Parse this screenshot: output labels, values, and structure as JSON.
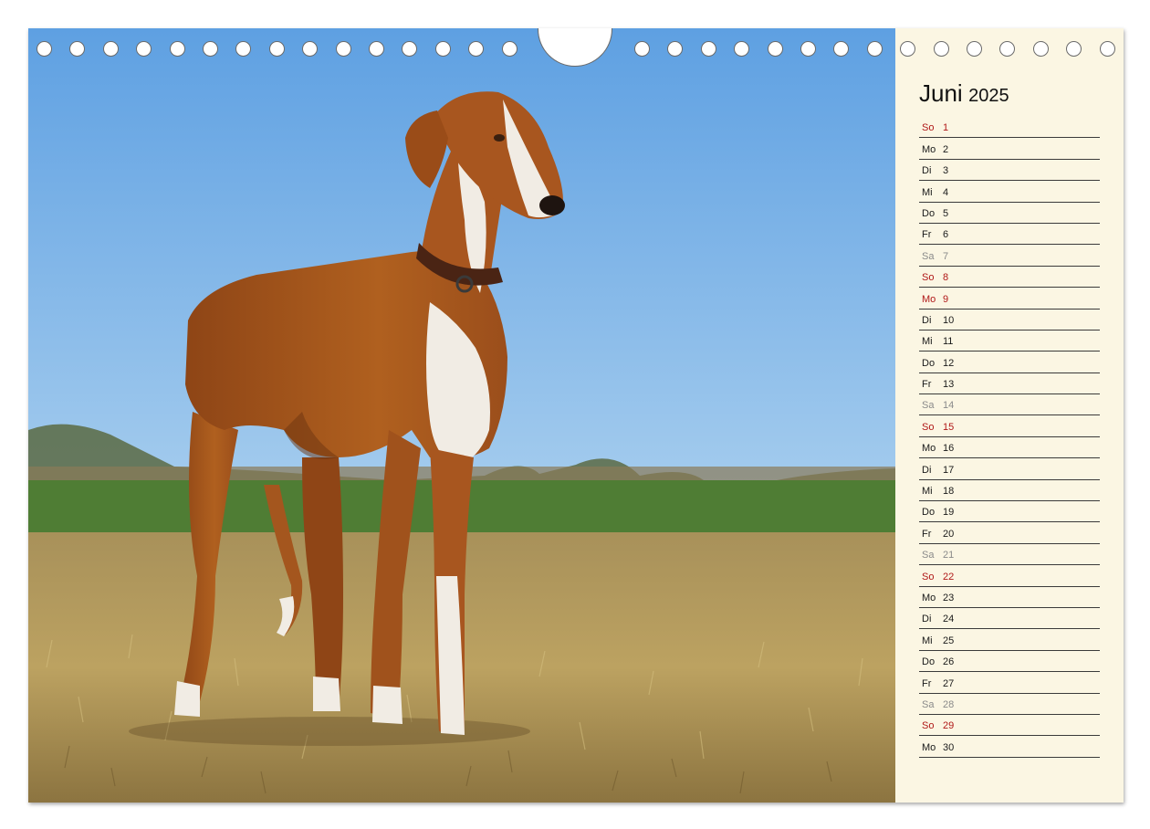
{
  "calendar": {
    "month": "Juni",
    "year": "2025",
    "days": [
      {
        "wd": "So",
        "n": "1",
        "type": "holiday"
      },
      {
        "wd": "Mo",
        "n": "2",
        "type": "weekday"
      },
      {
        "wd": "Di",
        "n": "3",
        "type": "weekday"
      },
      {
        "wd": "Mi",
        "n": "4",
        "type": "weekday"
      },
      {
        "wd": "Do",
        "n": "5",
        "type": "weekday"
      },
      {
        "wd": "Fr",
        "n": "6",
        "type": "weekday"
      },
      {
        "wd": "Sa",
        "n": "7",
        "type": "saturday"
      },
      {
        "wd": "So",
        "n": "8",
        "type": "holiday"
      },
      {
        "wd": "Mo",
        "n": "9",
        "type": "holiday"
      },
      {
        "wd": "Di",
        "n": "10",
        "type": "weekday"
      },
      {
        "wd": "Mi",
        "n": "11",
        "type": "weekday"
      },
      {
        "wd": "Do",
        "n": "12",
        "type": "weekday"
      },
      {
        "wd": "Fr",
        "n": "13",
        "type": "weekday"
      },
      {
        "wd": "Sa",
        "n": "14",
        "type": "saturday"
      },
      {
        "wd": "So",
        "n": "15",
        "type": "holiday"
      },
      {
        "wd": "Mo",
        "n": "16",
        "type": "weekday"
      },
      {
        "wd": "Di",
        "n": "17",
        "type": "weekday"
      },
      {
        "wd": "Mi",
        "n": "18",
        "type": "weekday"
      },
      {
        "wd": "Do",
        "n": "19",
        "type": "weekday"
      },
      {
        "wd": "Fr",
        "n": "20",
        "type": "weekday"
      },
      {
        "wd": "Sa",
        "n": "21",
        "type": "saturday"
      },
      {
        "wd": "So",
        "n": "22",
        "type": "holiday"
      },
      {
        "wd": "Mo",
        "n": "23",
        "type": "weekday"
      },
      {
        "wd": "Di",
        "n": "24",
        "type": "weekday"
      },
      {
        "wd": "Mi",
        "n": "25",
        "type": "weekday"
      },
      {
        "wd": "Do",
        "n": "26",
        "type": "weekday"
      },
      {
        "wd": "Fr",
        "n": "27",
        "type": "weekday"
      },
      {
        "wd": "Sa",
        "n": "28",
        "type": "saturday"
      },
      {
        "wd": "So",
        "n": "29",
        "type": "holiday"
      },
      {
        "wd": "Mo",
        "n": "30",
        "type": "weekday"
      }
    ]
  },
  "colors": {
    "sky": "#7db2e6",
    "field_green": "#4f7d34",
    "grass": "#b89d58",
    "dog_coat": "#a8561f",
    "dog_white": "#f1ece4",
    "holiday_red": "#b01818",
    "saturday_grey": "#8a8a8a",
    "panel_background": "#fbf6e3"
  }
}
